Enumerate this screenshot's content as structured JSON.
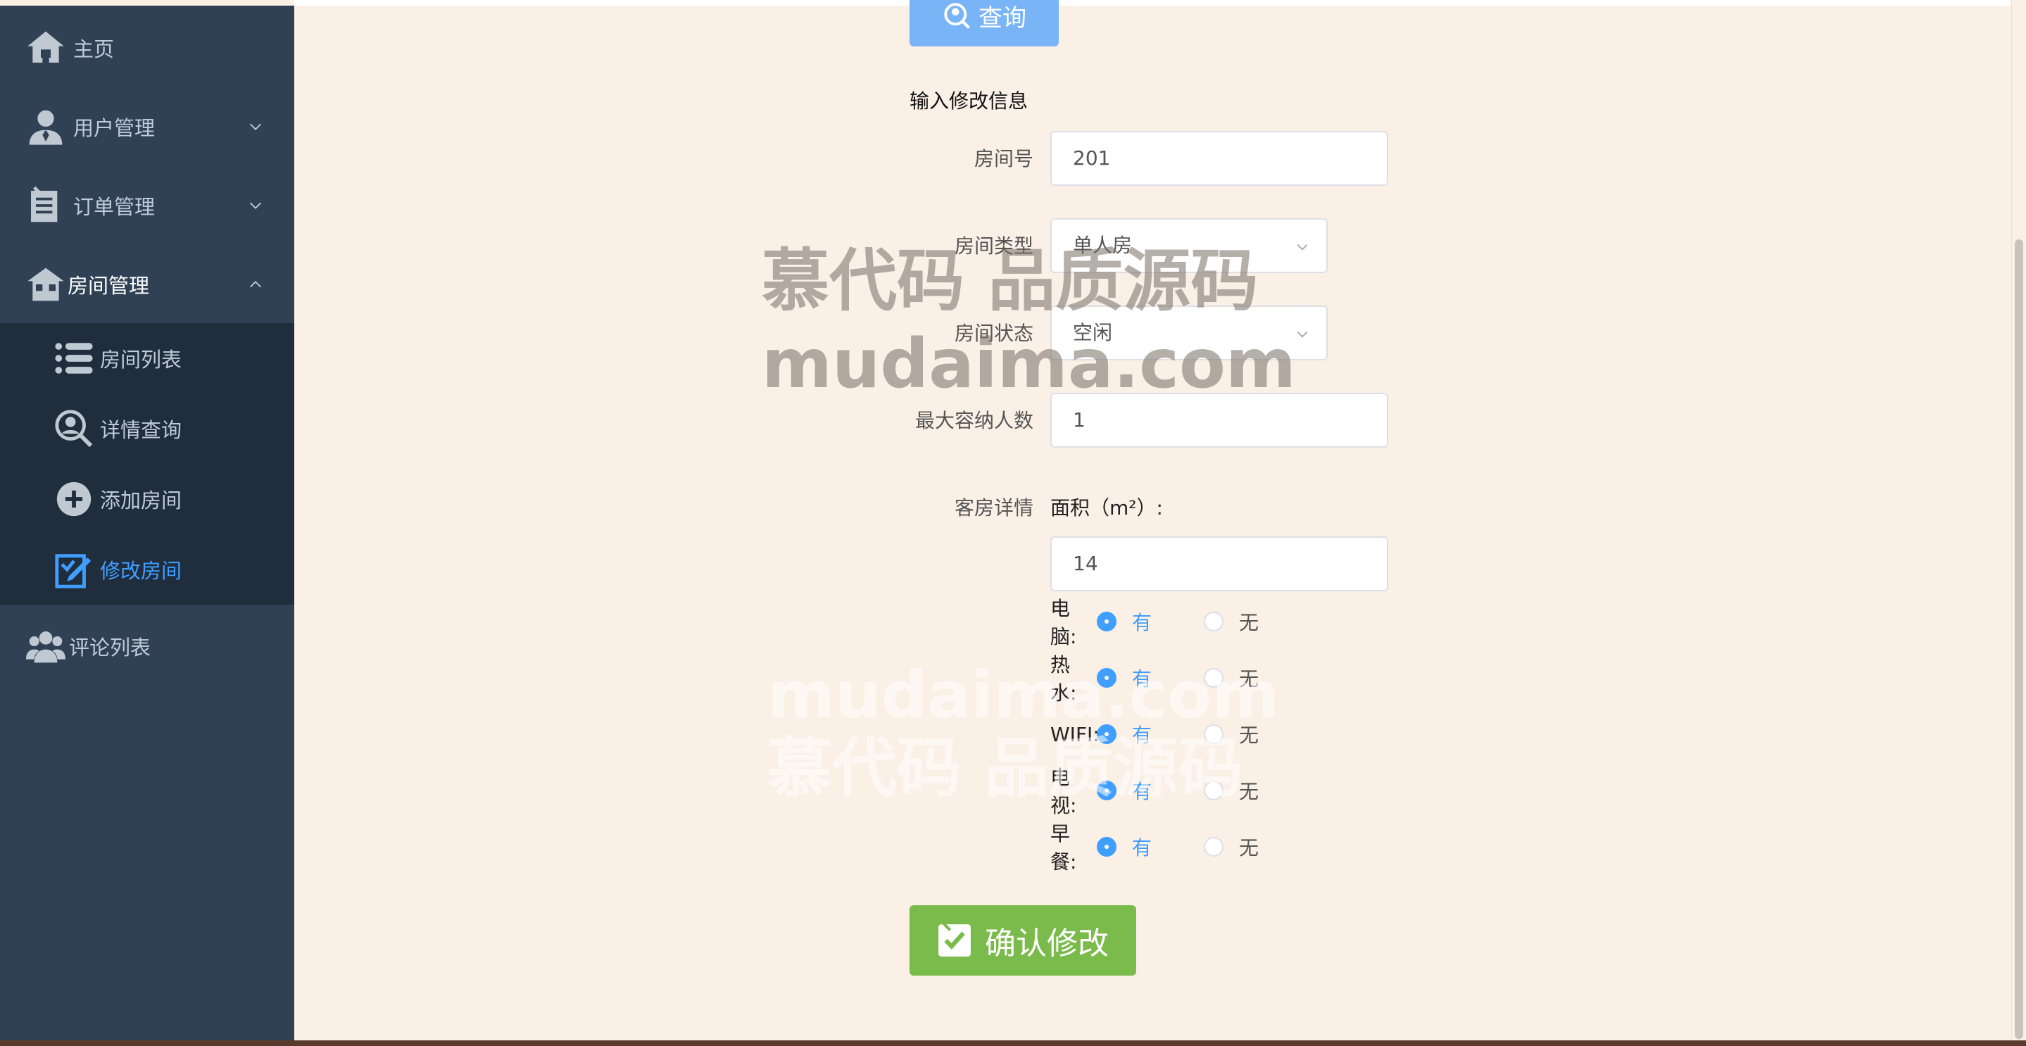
{
  "sidebar": {
    "items": [
      {
        "label": "主页",
        "icon": "home-icon"
      },
      {
        "label": "用户管理",
        "icon": "user-icon"
      },
      {
        "label": "订单管理",
        "icon": "order-icon"
      },
      {
        "label": "房间管理",
        "icon": "house-icon"
      },
      {
        "label": "评论列表",
        "icon": "users-icon"
      }
    ],
    "submenu": [
      {
        "label": "房间列表",
        "icon": "list-icon"
      },
      {
        "label": "详情查询",
        "icon": "search-icon"
      },
      {
        "label": "添加房间",
        "icon": "add-icon"
      },
      {
        "label": "修改房间",
        "icon": "edit-icon",
        "active": true
      }
    ]
  },
  "main": {
    "query_label": "查询",
    "section_title": "输入修改信息",
    "fields": {
      "room_no": {
        "label": "房间号",
        "value": "201"
      },
      "room_type": {
        "label": "房间类型",
        "value": "单人房"
      },
      "room_status": {
        "label": "房间状态",
        "value": "空闲"
      },
      "max_people": {
        "label": "最大容纳人数",
        "value": "1"
      }
    },
    "details": {
      "label": "客房详情",
      "area_label": "面积（m²）:",
      "area_value": "14",
      "options": [
        {
          "label": "电脑:",
          "yes": "有",
          "no": "无",
          "selected": "yes"
        },
        {
          "label": "热水:",
          "yes": "有",
          "no": "无",
          "selected": "yes"
        },
        {
          "label": "WIFI:",
          "yes": "有",
          "no": "无",
          "selected": "yes"
        },
        {
          "label": "电视:",
          "yes": "有",
          "no": "无",
          "selected": "yes"
        },
        {
          "label": "早餐:",
          "yes": "有",
          "no": "无",
          "selected": "yes"
        }
      ]
    },
    "confirm_label": "确认修改"
  },
  "watermark": {
    "line1": "慕代码 品质源码",
    "line2": "mudaima.com"
  },
  "colors": {
    "sidebar_bg": "#304156",
    "submenu_bg": "#1f2d3d",
    "active": "#409eff",
    "confirm": "#7bbb4c",
    "page_bg": "#faf0e6"
  }
}
